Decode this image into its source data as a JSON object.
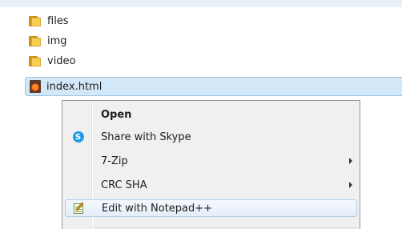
{
  "explorer": {
    "files": [
      {
        "name": "files",
        "type": "folder"
      },
      {
        "name": "img",
        "type": "folder"
      },
      {
        "name": "video",
        "type": "folder"
      },
      {
        "name": "index.html",
        "type": "html",
        "selected": true
      }
    ]
  },
  "context_menu": {
    "items": [
      {
        "label": "Open",
        "bold": true,
        "icon": "none",
        "submenu": false
      },
      {
        "label": "Share with Skype",
        "icon": "skype-icon",
        "submenu": false
      },
      {
        "label": "7-Zip",
        "icon": "none",
        "submenu": true
      },
      {
        "label": "CRC SHA",
        "icon": "none",
        "submenu": true
      },
      {
        "label": "Edit with Notepad++",
        "icon": "notepad-plus-plus-icon",
        "submenu": false,
        "highlighted": true
      }
    ]
  },
  "colors": {
    "selection_bg": "#d2e7f8",
    "menu_bg": "#f0f0f0",
    "folder": "#f6cf57",
    "skype": "#1e9de6"
  }
}
